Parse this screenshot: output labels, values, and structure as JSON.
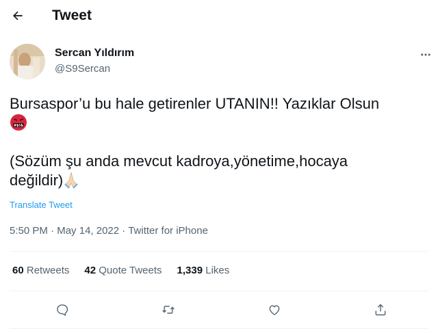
{
  "header": {
    "title": "Tweet",
    "back_icon": "arrow-left-icon"
  },
  "author": {
    "name": "Sercan Yıldırım",
    "handle": "@S9Sercan"
  },
  "tweet": {
    "line1": "Bursaspor’u bu hale getirenler UTANIN!! Yazıklar Olsun",
    "emoji1": "angry-face-with-symbols-emoji",
    "line3": "(Sözüm şu anda mevcut kadroya,yönetime,hocaya",
    "line4": "değildir)",
    "emoji2": "folded-hands-emoji"
  },
  "translate_label": "Translate Tweet",
  "meta": {
    "time": "5:50 PM",
    "sep1": " · ",
    "date": "May 14, 2022",
    "sep2": " · ",
    "source": "Twitter for iPhone"
  },
  "stats": {
    "retweets_count": "60",
    "retweets_label": "Retweets",
    "quotes_count": "42",
    "quotes_label": "Quote Tweets",
    "likes_count": "1,339",
    "likes_label": "Likes"
  },
  "actions": [
    "reply-icon",
    "retweet-icon",
    "like-icon",
    "share-icon"
  ],
  "colors": {
    "text": "#0f1419",
    "secondary": "#536471",
    "link": "#1d9bf0",
    "divider": "#eff3f4"
  }
}
